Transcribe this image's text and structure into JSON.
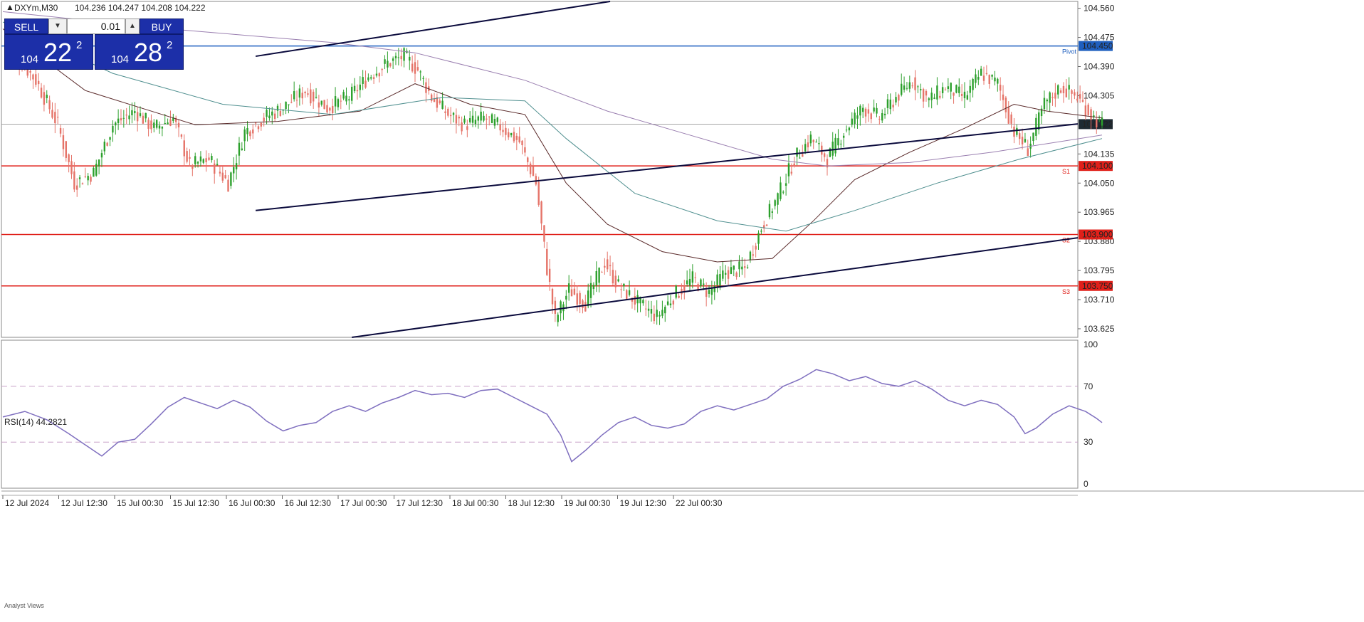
{
  "header": {
    "symbol_tf": "DXYm,M30",
    "ohlc": "104.236 104.247 104.208 104.222"
  },
  "trade_panel": {
    "sell_label": "SELL",
    "buy_label": "BUY",
    "lot": "0.01",
    "sell_price_small": "104",
    "sell_price_big": "22",
    "sell_price_sup": "2",
    "buy_price_small": "104",
    "buy_price_big": "28",
    "buy_price_sup": "2"
  },
  "rsi_label": "RSI(14) 44.2821",
  "bottom_label": "Analyst Views",
  "colors": {
    "bull": "#2ca02c",
    "bear": "#e57368",
    "support_line": "#e0201a",
    "pivot_line": "#1f5fbf",
    "trend_line": "#0a0a3c",
    "rsi_line": "#7f6fbf",
    "ma_dark": "#5a2a2a",
    "ma_purple": "#9a7fb0",
    "ma_teal": "#4f8f8f"
  },
  "chart_data": {
    "type": "candlestick",
    "y_ticks": [
      "104.560",
      "104.475",
      "104.390",
      "104.305",
      "104.135",
      "104.050",
      "103.965",
      "103.880",
      "103.795",
      "103.710",
      "103.625"
    ],
    "ylim": [
      103.6,
      104.58
    ],
    "x_ticks": [
      "12 Jul 2024",
      "12 Jul 12:30",
      "15 Jul 00:30",
      "15 Jul 12:30",
      "16 Jul 00:30",
      "16 Jul 12:30",
      "17 Jul 00:30",
      "17 Jul 12:30",
      "18 Jul 00:30",
      "18 Jul 12:30",
      "19 Jul 00:30",
      "19 Jul 12:30",
      "22 Jul 00:30"
    ],
    "current_price": "104.222",
    "levels": [
      {
        "price": "104.450",
        "tag": "Pivot",
        "type": "pivot"
      },
      {
        "price": "104.100",
        "tag": "S1",
        "type": "support"
      },
      {
        "price": "103.900",
        "tag": "S2",
        "type": "support"
      },
      {
        "price": "103.750",
        "tag": "S3",
        "type": "support"
      }
    ],
    "close_path": [
      [
        0,
        104.47
      ],
      [
        12,
        104.35
      ],
      [
        20,
        104.22
      ],
      [
        26,
        104.05
      ],
      [
        33,
        104.08
      ],
      [
        40,
        104.22
      ],
      [
        48,
        104.26
      ],
      [
        55,
        104.21
      ],
      [
        62,
        104.24
      ],
      [
        68,
        104.1
      ],
      [
        75,
        104.12
      ],
      [
        82,
        104.05
      ],
      [
        88,
        104.2
      ],
      [
        95,
        104.24
      ],
      [
        102,
        104.27
      ],
      [
        110,
        104.32
      ],
      [
        118,
        104.27
      ],
      [
        126,
        104.3
      ],
      [
        133,
        104.36
      ],
      [
        140,
        104.4
      ],
      [
        146,
        104.42
      ],
      [
        151,
        104.38
      ],
      [
        156,
        104.3
      ],
      [
        162,
        104.25
      ],
      [
        168,
        104.22
      ],
      [
        175,
        104.24
      ],
      [
        182,
        104.21
      ],
      [
        188,
        104.17
      ],
      [
        194,
        104.05
      ],
      [
        198,
        103.8
      ],
      [
        201,
        103.65
      ],
      [
        206,
        103.74
      ],
      [
        212,
        103.7
      ],
      [
        219,
        103.82
      ],
      [
        224,
        103.75
      ],
      [
        231,
        103.7
      ],
      [
        238,
        103.66
      ],
      [
        244,
        103.72
      ],
      [
        251,
        103.77
      ],
      [
        257,
        103.73
      ],
      [
        263,
        103.79
      ],
      [
        270,
        103.8
      ],
      [
        276,
        103.92
      ],
      [
        282,
        104.01
      ],
      [
        288,
        104.12
      ],
      [
        294,
        104.18
      ],
      [
        300,
        104.12
      ],
      [
        306,
        104.2
      ],
      [
        313,
        104.27
      ],
      [
        319,
        104.24
      ],
      [
        325,
        104.3
      ],
      [
        331,
        104.35
      ],
      [
        337,
        104.29
      ],
      [
        343,
        104.33
      ],
      [
        350,
        104.3
      ],
      [
        356,
        104.37
      ],
      [
        362,
        104.34
      ],
      [
        368,
        104.2
      ],
      [
        373,
        104.15
      ],
      [
        379,
        104.28
      ],
      [
        385,
        104.33
      ],
      [
        391,
        104.3
      ],
      [
        397,
        104.24
      ],
      [
        400,
        104.22
      ]
    ],
    "moving_averages": [
      {
        "color_key": "ma_dark",
        "points": [
          [
            0,
            104.5
          ],
          [
            30,
            104.32
          ],
          [
            50,
            104.27
          ],
          [
            70,
            104.22
          ],
          [
            100,
            104.23
          ],
          [
            130,
            104.26
          ],
          [
            150,
            104.34
          ],
          [
            170,
            104.28
          ],
          [
            190,
            104.25
          ],
          [
            205,
            104.05
          ],
          [
            220,
            103.93
          ],
          [
            240,
            103.85
          ],
          [
            260,
            103.82
          ],
          [
            280,
            103.83
          ],
          [
            295,
            103.94
          ],
          [
            310,
            104.06
          ],
          [
            330,
            104.14
          ],
          [
            350,
            104.21
          ],
          [
            368,
            104.28
          ],
          [
            380,
            104.26
          ],
          [
            400,
            104.24
          ]
        ]
      },
      {
        "color_key": "ma_purple",
        "points": [
          [
            0,
            104.55
          ],
          [
            60,
            104.5
          ],
          [
            120,
            104.46
          ],
          [
            150,
            104.43
          ],
          [
            190,
            104.35
          ],
          [
            220,
            104.26
          ],
          [
            250,
            104.19
          ],
          [
            280,
            104.12
          ],
          [
            300,
            104.1
          ],
          [
            330,
            104.11
          ],
          [
            360,
            104.14
          ],
          [
            400,
            104.19
          ]
        ]
      },
      {
        "color_key": "ma_teal",
        "points": [
          [
            0,
            104.52
          ],
          [
            40,
            104.37
          ],
          [
            80,
            104.28
          ],
          [
            120,
            104.25
          ],
          [
            160,
            104.3
          ],
          [
            190,
            104.29
          ],
          [
            205,
            104.18
          ],
          [
            230,
            104.02
          ],
          [
            260,
            103.94
          ],
          [
            285,
            103.91
          ],
          [
            310,
            103.97
          ],
          [
            340,
            104.05
          ],
          [
            370,
            104.12
          ],
          [
            400,
            104.18
          ]
        ]
      }
    ],
    "trend_lines": [
      {
        "from": [
          92,
          104.42
        ],
        "to": [
          221,
          104.58
        ]
      },
      {
        "from": [
          92,
          103.97
        ],
        "to": [
          400,
          104.23
        ],
        "extend": true
      },
      {
        "from": [
          127,
          103.6
        ],
        "to": [
          400,
          103.9
        ],
        "extend": true
      }
    ],
    "rsi": {
      "ylim": [
        0,
        100
      ],
      "ticks": [
        "100",
        "70",
        "30",
        "0"
      ],
      "levels": [
        70,
        30
      ],
      "points": [
        [
          0,
          48
        ],
        [
          8,
          52
        ],
        [
          16,
          46
        ],
        [
          24,
          36
        ],
        [
          30,
          28
        ],
        [
          36,
          20
        ],
        [
          42,
          30
        ],
        [
          48,
          32
        ],
        [
          54,
          43
        ],
        [
          60,
          55
        ],
        [
          66,
          62
        ],
        [
          72,
          58
        ],
        [
          78,
          54
        ],
        [
          84,
          60
        ],
        [
          90,
          55
        ],
        [
          96,
          45
        ],
        [
          102,
          38
        ],
        [
          108,
          42
        ],
        [
          114,
          44
        ],
        [
          120,
          52
        ],
        [
          126,
          56
        ],
        [
          132,
          52
        ],
        [
          138,
          58
        ],
        [
          144,
          62
        ],
        [
          150,
          67
        ],
        [
          156,
          64
        ],
        [
          162,
          65
        ],
        [
          168,
          62
        ],
        [
          174,
          67
        ],
        [
          180,
          68
        ],
        [
          186,
          62
        ],
        [
          192,
          56
        ],
        [
          198,
          50
        ],
        [
          203,
          35
        ],
        [
          207,
          16
        ],
        [
          212,
          24
        ],
        [
          218,
          35
        ],
        [
          224,
          44
        ],
        [
          230,
          48
        ],
        [
          236,
          42
        ],
        [
          242,
          40
        ],
        [
          248,
          43
        ],
        [
          254,
          52
        ],
        [
          260,
          56
        ],
        [
          266,
          53
        ],
        [
          272,
          57
        ],
        [
          278,
          61
        ],
        [
          284,
          70
        ],
        [
          290,
          75
        ],
        [
          296,
          82
        ],
        [
          302,
          79
        ],
        [
          308,
          74
        ],
        [
          314,
          77
        ],
        [
          320,
          72
        ],
        [
          326,
          70
        ],
        [
          332,
          74
        ],
        [
          338,
          68
        ],
        [
          344,
          60
        ],
        [
          350,
          56
        ],
        [
          356,
          60
        ],
        [
          362,
          57
        ],
        [
          368,
          48
        ],
        [
          372,
          36
        ],
        [
          376,
          40
        ],
        [
          382,
          50
        ],
        [
          388,
          56
        ],
        [
          394,
          52
        ],
        [
          398,
          47
        ],
        [
          400,
          44
        ]
      ]
    }
  }
}
